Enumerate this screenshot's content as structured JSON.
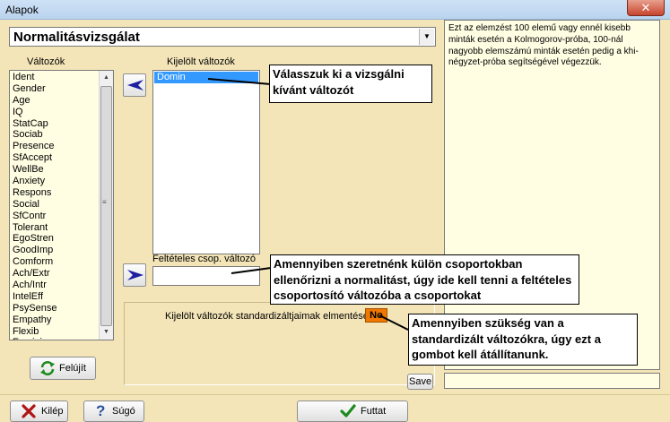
{
  "window": {
    "title": "Alapok",
    "close_glyph": "✕"
  },
  "analysis_select": {
    "selected": "Normalitásvizsgálat"
  },
  "variables": {
    "label": "Változók",
    "items": [
      "Ident",
      "Gender",
      "Age",
      "IQ",
      "StatCap",
      "Sociab",
      "Presence",
      "SfAccept",
      "WellBe",
      "Anxiety",
      "Respons",
      "Social",
      "SfContr",
      "Tolerant",
      "EgoStren",
      "GoodImp",
      "Comform",
      "Ach/Extr",
      "Ach/Intr",
      "IntelEff",
      "PsySense",
      "Empathy",
      "Flexib",
      "Femini"
    ]
  },
  "selected_variables": {
    "label": "Kijelölt változók",
    "items": [
      "Domin"
    ]
  },
  "group_variable": {
    "label": "Feltételes csop. változó",
    "value": ""
  },
  "standardize": {
    "label": "Kijelölt változók standardizáltjaimak elmentése",
    "toggle_value": "No"
  },
  "buttons": {
    "save": "Save",
    "refresh": "Felújít",
    "exit": "Kilép",
    "help": "Súgó",
    "run": "Futtat"
  },
  "help_text": "Ezt az elemzést 100 elemű vagy ennél kisebb minták esetén a Kolmogorov-próba, 100-nál nagyobb elemszámú minták esetén pedig a khi-négyzet-próba segítségével végezzük.",
  "callouts": {
    "select_variable": "Válasszuk ki a vizsgálni kívánt változót",
    "group_variable": "Amennyiben szeretnénk külön csoportokban ellenőrizni a normalitást, úgy ide kell tenni a feltételes csoportosító változóba a csoportokat",
    "standardize": "Amennyiben szükség van a standardizált változókra, úgy ezt a gombot kell átállítanunk."
  },
  "colors": {
    "accent_button": "#f07800",
    "list_background": "#fffde2",
    "form_background": "#f3e5b8",
    "selection": "#3399ff"
  }
}
